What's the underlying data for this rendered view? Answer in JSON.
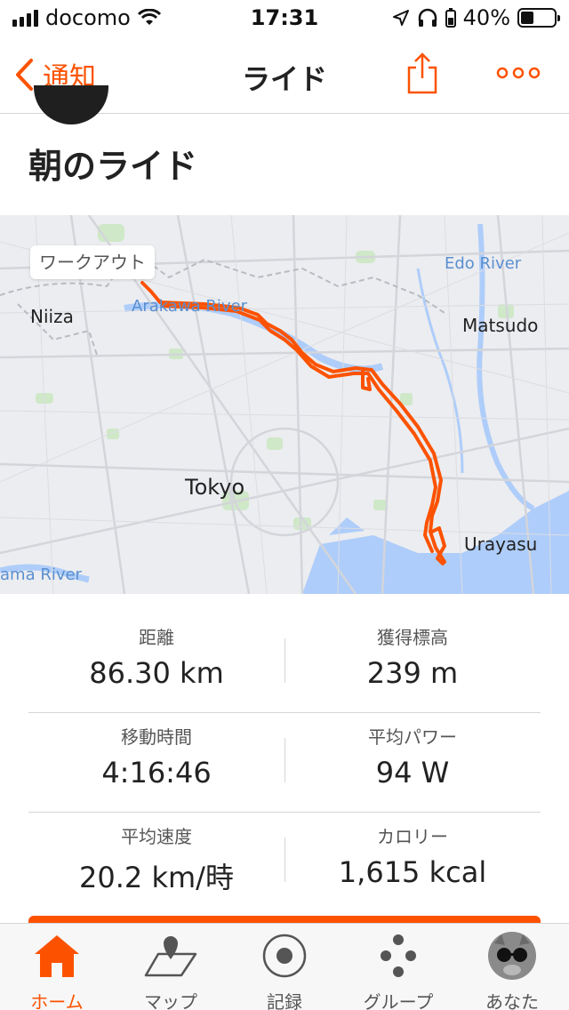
{
  "status_bar": {
    "carrier": "docomo",
    "time": "17:31",
    "battery": "40%",
    "battery_level": 0.4
  },
  "nav": {
    "back_label": "通知",
    "title": "ライド"
  },
  "activity": {
    "title": "朝のライド"
  },
  "map": {
    "badge": "ワークアウト",
    "labels": {
      "niiza": "Niiza",
      "arakawa": "Arakawa River",
      "edo": "Edo River",
      "matsudo": "Matsudo",
      "tokyo": "Tokyo",
      "urayasu": "Urayasu",
      "tama": "ama River"
    },
    "route_color": "#fc5200"
  },
  "stats": [
    {
      "label": "距離",
      "value": "86.30 km"
    },
    {
      "label": "獲得標高",
      "value": "239 m"
    },
    {
      "label": "移動時間",
      "value": "4:16:46"
    },
    {
      "label": "平均パワー",
      "value": "94 W"
    },
    {
      "label": "平均速度",
      "value": "20.2 km/時"
    },
    {
      "label": "カロリー",
      "value": "1,615 kcal"
    }
  ],
  "tabs": [
    {
      "label": "ホーム",
      "icon": "home-icon",
      "active": true
    },
    {
      "label": "マップ",
      "icon": "map-icon",
      "active": false
    },
    {
      "label": "記録",
      "icon": "record-icon",
      "active": false
    },
    {
      "label": "グループ",
      "icon": "groups-icon",
      "active": false
    },
    {
      "label": "あなた",
      "icon": "profile-avatar",
      "active": false
    }
  ],
  "colors": {
    "accent": "#fc5200",
    "map_bg": "#ecedf0",
    "text": "#222222"
  }
}
